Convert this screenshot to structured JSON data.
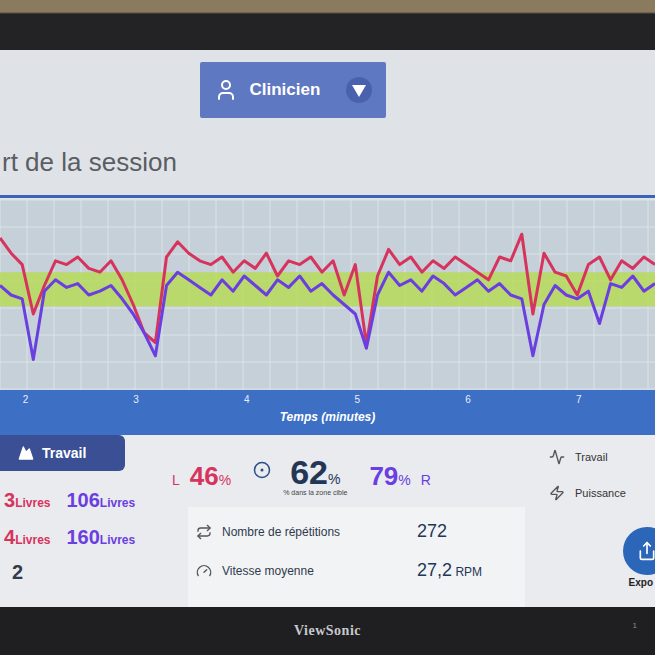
{
  "header": {
    "user_menu": {
      "label": "Clinicien"
    }
  },
  "title": "rt de la session",
  "chart": {
    "x_axis": {
      "label": "Temps (minutes)",
      "ticks": [
        "2",
        "3",
        "4",
        "5",
        "6",
        "7"
      ],
      "range": [
        1.77,
        7.69
      ]
    },
    "y_range": [
      0,
      100
    ],
    "target_zone": [
      44,
      62
    ],
    "series": [
      {
        "color": "#d7345d",
        "values": [
          80,
          72,
          66,
          40,
          55,
          68,
          66,
          70,
          64,
          62,
          68,
          58,
          45,
          30,
          25,
          70,
          78,
          72,
          68,
          66,
          70,
          62,
          68,
          64,
          72,
          60,
          68,
          66,
          70,
          62,
          68,
          50,
          66,
          24,
          60,
          74,
          66,
          70,
          62,
          68,
          64,
          70,
          66,
          62,
          58,
          70,
          68,
          82,
          40,
          72,
          62,
          60,
          50,
          66,
          70,
          58,
          68,
          64,
          70,
          66
        ]
      },
      {
        "color": "#6a3ee0",
        "values": [
          55,
          50,
          48,
          16,
          52,
          58,
          54,
          56,
          50,
          52,
          55,
          48,
          40,
          30,
          18,
          55,
          62,
          58,
          54,
          50,
          58,
          52,
          60,
          55,
          50,
          58,
          54,
          60,
          52,
          56,
          50,
          45,
          40,
          22,
          50,
          62,
          55,
          58,
          52,
          60,
          56,
          50,
          54,
          58,
          52,
          56,
          50,
          48,
          18,
          45,
          55,
          50,
          48,
          52,
          35,
          56,
          54,
          60,
          52,
          56
        ]
      }
    ]
  },
  "tab": {
    "label": "Travail",
    "selected": true
  },
  "loads": {
    "rows": [
      {
        "cells": [
          {
            "value": "3",
            "unit": "Livres",
            "color": "#d7345d"
          },
          {
            "value": "106",
            "unit": "Livres",
            "color": "#6a3ee0"
          }
        ]
      },
      {
        "cells": [
          {
            "value": "4",
            "unit": "Livres",
            "color": "#d7345d"
          },
          {
            "value": "160",
            "unit": "Livres",
            "color": "#6a3ee0"
          }
        ]
      }
    ],
    "footer": "2"
  },
  "metrics": {
    "left": {
      "label": "L",
      "value": "46",
      "unit": "%",
      "color": "#d7345d"
    },
    "zone": {
      "value": "62",
      "unit": "%",
      "caption": "% dans la zone cible"
    },
    "right": {
      "label": "R",
      "value": "79",
      "unit": "%",
      "color": "#6a3ee0"
    }
  },
  "stats": [
    {
      "label": "Nombre de répétitions",
      "value": "272"
    },
    {
      "label": "Vitesse moyenne",
      "value": "27,2",
      "unit": "RPM"
    }
  ],
  "side_menu": [
    {
      "label": "Travail"
    },
    {
      "label": "Puissance"
    }
  ],
  "export": {
    "label": "Expo"
  },
  "bezel": {
    "brand": "ViewSonic",
    "indicator": "1"
  }
}
